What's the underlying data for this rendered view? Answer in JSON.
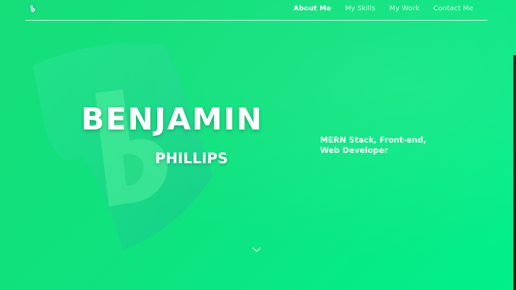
{
  "header": {
    "logo_icon": "b-logo-icon",
    "nav": [
      {
        "label": "About Me",
        "active": true
      },
      {
        "label": "My Skills",
        "active": false
      },
      {
        "label": "My Work",
        "active": false
      },
      {
        "label": "Contact Me",
        "active": false
      }
    ]
  },
  "hero": {
    "first_name": "BENJAMIN",
    "last_name": "PHILLIPS",
    "tagline_line1": "MERN Stack, Front-end,",
    "tagline_line2": "Web Developer",
    "scroll_icon": "chevron-down-icon"
  },
  "colors": {
    "background_start": "#16de79",
    "background_end": "#00f08a",
    "text": "#ffffff",
    "watermark": "#3fe89a"
  }
}
